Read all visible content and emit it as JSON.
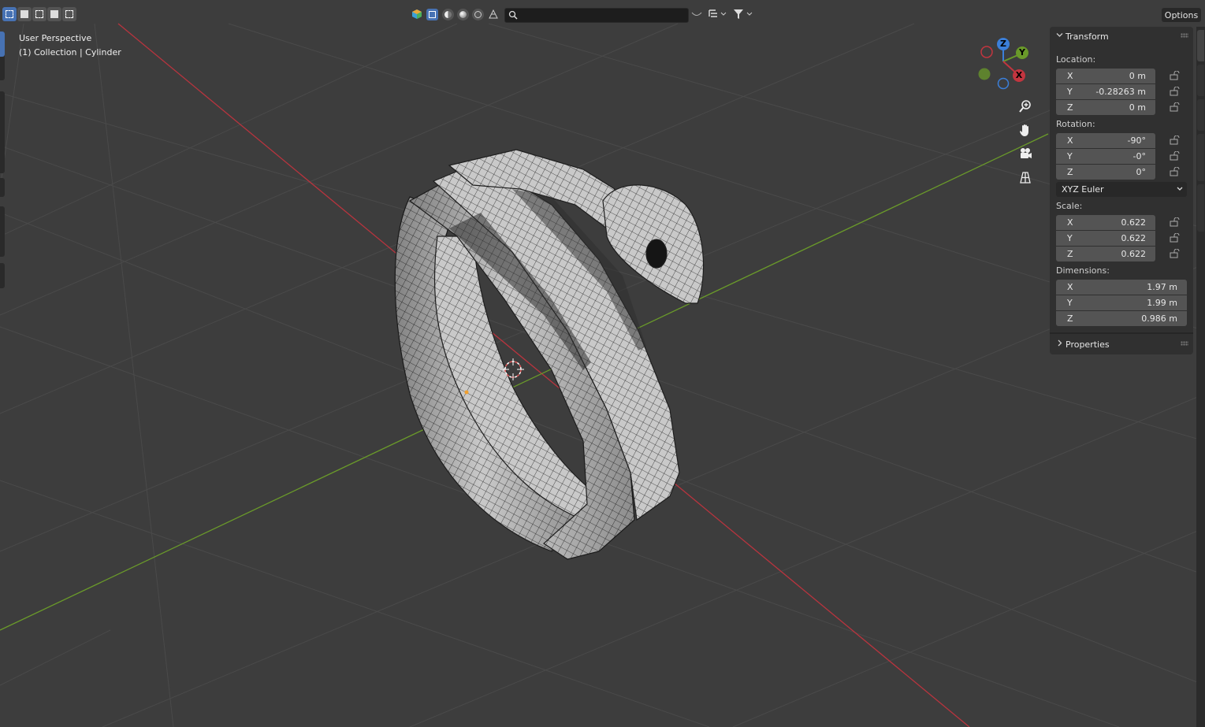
{
  "viewport": {
    "perspective_label": "User Perspective",
    "collection_label": "(1) Collection | Cylinder"
  },
  "header": {
    "search_placeholder": "",
    "options_label": "Options",
    "select_modes": [
      "select-set-new",
      "select-extend",
      "select-subtract",
      "select-difference",
      "select-intersect"
    ],
    "shading_modes": [
      "wireframe",
      "solid",
      "material-preview",
      "rendered"
    ]
  },
  "gizmo": {
    "x_label": "X",
    "y_label": "Y",
    "z_label": "Z"
  },
  "n_panel": {
    "transform_title": "Transform",
    "location_label": "Location:",
    "location": [
      {
        "axis": "X",
        "value": "0 m"
      },
      {
        "axis": "Y",
        "value": "-0.28263 m"
      },
      {
        "axis": "Z",
        "value": "0 m"
      }
    ],
    "rotation_label": "Rotation:",
    "rotation": [
      {
        "axis": "X",
        "value": "-90°"
      },
      {
        "axis": "Y",
        "value": "-0°"
      },
      {
        "axis": "Z",
        "value": "0°"
      }
    ],
    "rotation_mode": "XYZ Euler",
    "scale_label": "Scale:",
    "scale": [
      {
        "axis": "X",
        "value": "0.622"
      },
      {
        "axis": "Y",
        "value": "0.622"
      },
      {
        "axis": "Z",
        "value": "0.622"
      }
    ],
    "dimensions_label": "Dimensions:",
    "dimensions": [
      {
        "axis": "X",
        "value": "1.97 m"
      },
      {
        "axis": "Y",
        "value": "1.99 m"
      },
      {
        "axis": "Z",
        "value": "0.986 m"
      }
    ],
    "properties_title": "Properties"
  },
  "colors": {
    "background": "#3d3d3d",
    "x_axis": "#c2353f",
    "y_axis": "#6d9a2b",
    "z_axis": "#3b7fd9",
    "accent": "#4772b3"
  }
}
